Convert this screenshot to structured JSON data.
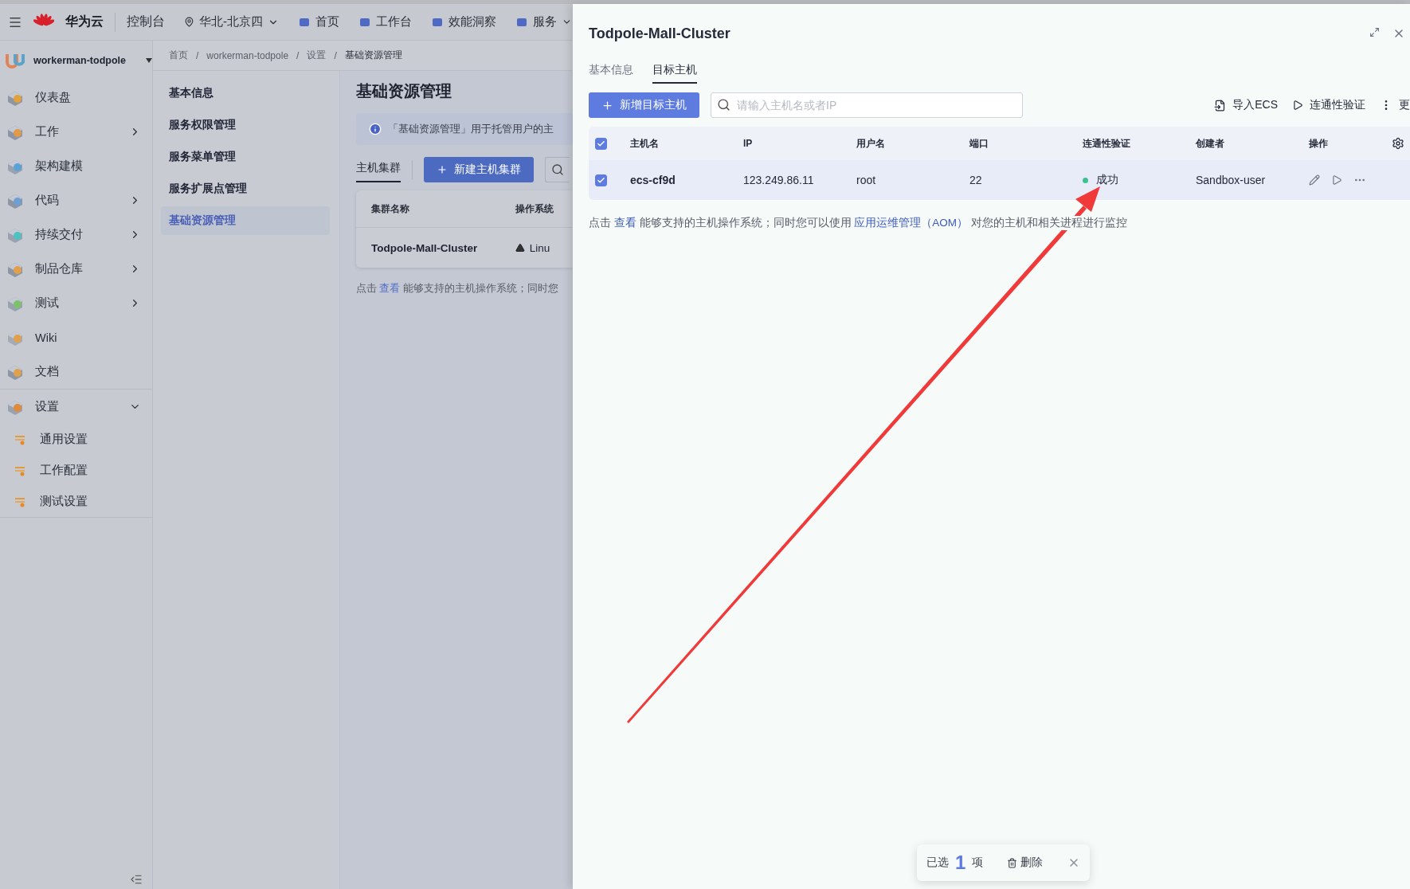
{
  "top_bar": {
    "brand": "华为云",
    "console": "控制台",
    "region": "华北-北京四",
    "nav": [
      {
        "label": "首页",
        "dropdown": false
      },
      {
        "label": "工作台",
        "dropdown": false
      },
      {
        "label": "效能洞察",
        "dropdown": false
      },
      {
        "label": "服务",
        "dropdown": true
      }
    ]
  },
  "sidebar": {
    "project": "workerman-todpole",
    "items": [
      {
        "label": "仪表盘",
        "kind": "link"
      },
      {
        "label": "工作",
        "kind": "group",
        "expanded": false
      },
      {
        "label": "架构建模",
        "kind": "link"
      },
      {
        "label": "代码",
        "kind": "group",
        "expanded": false
      },
      {
        "label": "持续交付",
        "kind": "group",
        "expanded": false
      },
      {
        "label": "制品仓库",
        "kind": "group",
        "expanded": false
      },
      {
        "label": "测试",
        "kind": "group",
        "expanded": false
      },
      {
        "label": "Wiki",
        "kind": "link"
      },
      {
        "label": "文档",
        "kind": "link"
      },
      {
        "label": "设置",
        "kind": "group",
        "expanded": true,
        "children": [
          {
            "label": "通用设置"
          },
          {
            "label": "工作配置"
          },
          {
            "label": "测试设置"
          }
        ]
      }
    ]
  },
  "breadcrumb": [
    "首页",
    "workerman-todpole",
    "设置",
    "基础资源管理"
  ],
  "breadcrumb_separator": "/",
  "settings_menu": [
    {
      "label": "基本信息",
      "selected": false
    },
    {
      "label": "服务权限管理",
      "selected": false
    },
    {
      "label": "服务菜单管理",
      "selected": false
    },
    {
      "label": "服务扩展点管理",
      "selected": false
    },
    {
      "label": "基础资源管理",
      "selected": true
    }
  ],
  "main": {
    "title": "基础资源管理",
    "info": "「基础资源管理」用于托管用户的主",
    "tabs": [
      {
        "label": "主机集群",
        "selected": true
      }
    ],
    "new_button": "新建主机集群",
    "table": {
      "columns": [
        "集群名称",
        "操作系统"
      ],
      "rows": [
        [
          "Todpole-Mall-Cluster",
          "Linu"
        ]
      ]
    },
    "note": [
      {
        "kind": "text",
        "text": "点击"
      },
      {
        "kind": "link",
        "text": "查看"
      },
      {
        "kind": "text",
        "text": "能够支持的主机操作系统；同时您"
      }
    ]
  },
  "drawer": {
    "title": "Todpole-Mall-Cluster",
    "tabs": [
      {
        "label": "基本信息",
        "selected": false
      },
      {
        "label": "目标主机",
        "selected": true
      }
    ],
    "add_button": "新增目标主机",
    "search": {
      "placeholder": "请输入主机名或者IP"
    },
    "actions": [
      {
        "label": "导入ECS",
        "kind": "import"
      },
      {
        "label": "连通性验证",
        "kind": "play"
      },
      {
        "label": "更",
        "kind": "more"
      }
    ],
    "table": {
      "all_checked": true,
      "columns": [
        "主机名",
        "IP",
        "用户名",
        "端口",
        "连通性验证",
        "创建者",
        "操作"
      ],
      "rows": [
        {
          "checked": true,
          "host": "ecs-cf9d",
          "ip": "123.249.86.11",
          "user": "root",
          "port": "22",
          "status": {
            "text": "成功",
            "color": "#3cc18f"
          },
          "creator": "Sandbox-user"
        }
      ]
    },
    "note": [
      {
        "kind": "text",
        "text": "点击"
      },
      {
        "kind": "link",
        "text": "查看"
      },
      {
        "kind": "text",
        "text": "能够支持的主机操作系统；同时您可以使用"
      },
      {
        "kind": "link",
        "text": "应用运维管理（AOM）"
      },
      {
        "kind": "text",
        "text": "对您的主机和相关进程进行监控"
      }
    ],
    "selection_bar": {
      "prefix": "已选",
      "count": "1",
      "suffix": "项",
      "delete": "删除"
    }
  }
}
